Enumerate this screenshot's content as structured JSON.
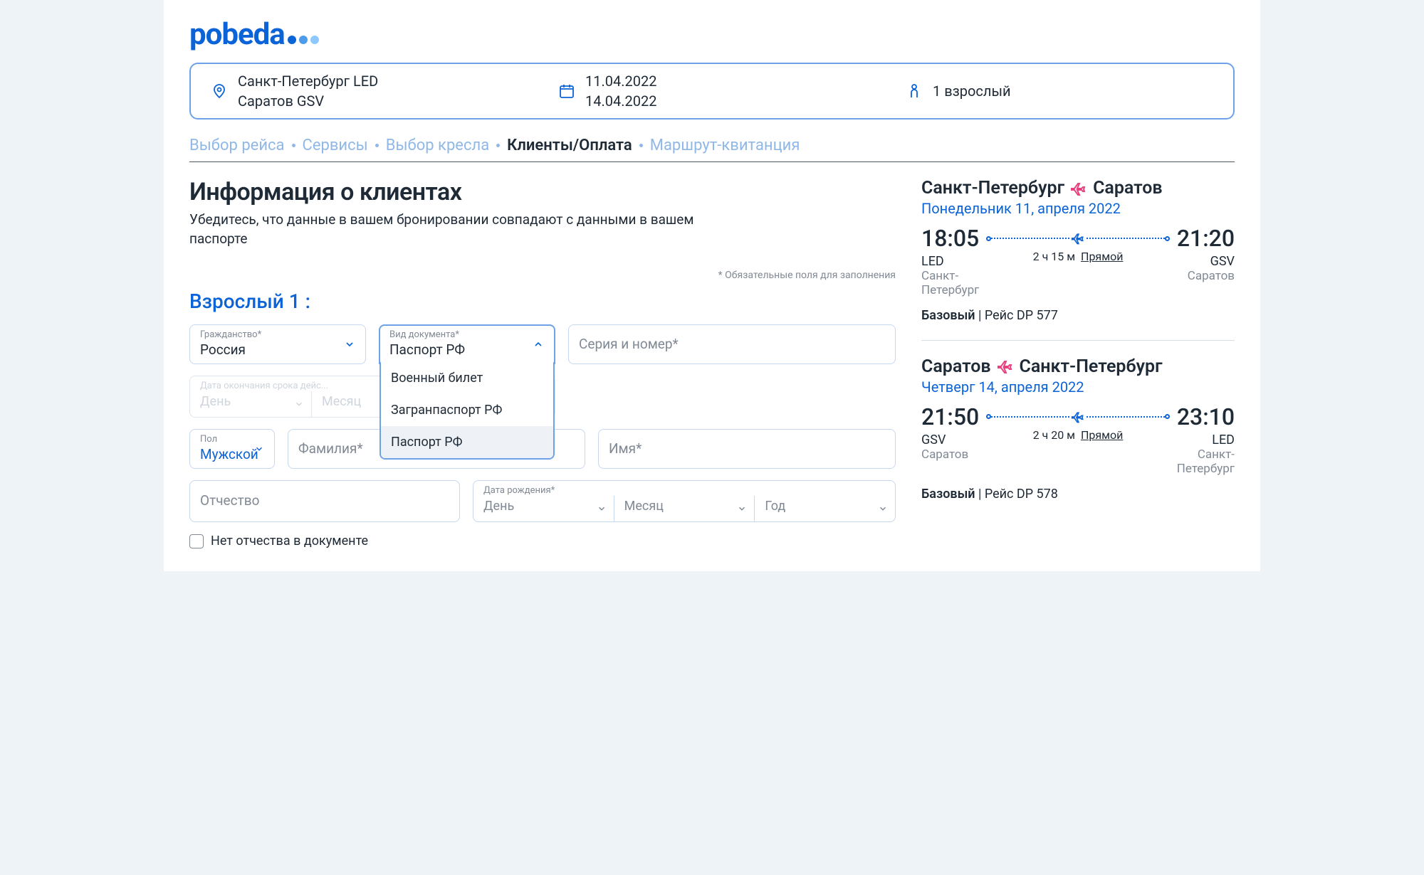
{
  "logo_text": "pobeda",
  "search": {
    "from": "Санкт-Петербург LED",
    "to": "Саратов GSV",
    "date_out": "11.04.2022",
    "date_back": "14.04.2022",
    "pax": "1 взрослый"
  },
  "crumbs": [
    "Выбор рейса",
    "Сервисы",
    "Выбор кресла",
    "Клиенты/Оплата",
    "Маршрут-квитанция"
  ],
  "crumb_active_index": 3,
  "heading": "Информация о клиентах",
  "subheading": "Убедитесь, что данные в вашем бронировании совпадают с данными в вашем паспорте",
  "required_hint": "* Обязательные поля для заполнения",
  "pax_title": "Взрослый 1 :",
  "form": {
    "citizenship_label": "Гражданство*",
    "citizenship_value": "Россия",
    "doc_type_label": "Вид документа*",
    "doc_type_value": "Паспорт РФ",
    "doc_type_options": [
      "Военный билет",
      "Загранпаспорт РФ",
      "Паспорт РФ"
    ],
    "doc_type_selected_index": 2,
    "serial_placeholder": "Серия и номер*",
    "expiry_label": "Дата окончания срока дейс...",
    "day": "День",
    "month": "Месяц",
    "year": "Год",
    "gender_label": "Пол",
    "gender_value": "Мужской",
    "surname_placeholder": "Фамилия*",
    "name_placeholder": "Имя*",
    "patronymic_placeholder": "Отчество",
    "dob_label": "Дата рождения*",
    "no_patronymic": "Нет отчества в документе"
  },
  "itinerary": [
    {
      "from_city": "Санкт-Петербург",
      "to_city": "Саратов",
      "date": "Понедельник 11, апреля 2022",
      "dep_time": "18:05",
      "dep_code": "LED",
      "dep_city": "Санкт-Петербург",
      "arr_time": "21:20",
      "arr_code": "GSV",
      "arr_city": "Саратов",
      "duration": "2 ч 15 м",
      "stops": "Прямой",
      "fare": "Базовый",
      "flight": "Рейс DP 577"
    },
    {
      "from_city": "Саратов",
      "to_city": "Санкт-Петербург",
      "date": "Четверг 14, апреля 2022",
      "dep_time": "21:50",
      "dep_code": "GSV",
      "dep_city": "Саратов",
      "arr_time": "23:10",
      "arr_code": "LED",
      "arr_city": "Санкт-Петербург",
      "duration": "2 ч 20 м",
      "stops": "Прямой",
      "fare": "Базовый",
      "flight": "Рейс DP 578"
    }
  ]
}
